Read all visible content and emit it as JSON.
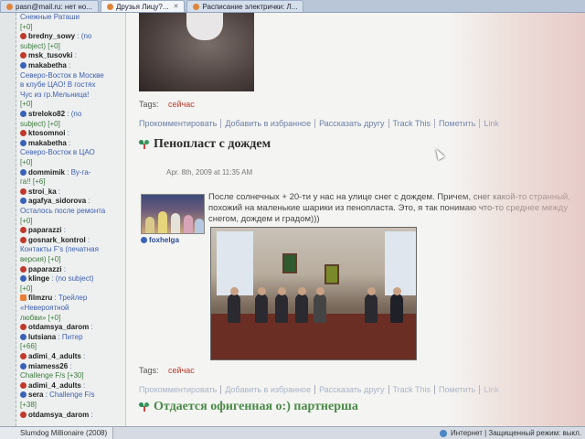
{
  "browser": {
    "tabs": [
      {
        "label": "pasn@mail.ru: нет но...",
        "active": false
      },
      {
        "label": "Друзья Лицу?...",
        "active": true
      },
      {
        "label": "Расписание электрички: Л...",
        "active": false
      }
    ]
  },
  "sidebar": {
    "entries": [
      {
        "kind": "text",
        "text": "Снежные Раташи"
      },
      {
        "kind": "text",
        "text": "[+0]"
      },
      {
        "kind": "user",
        "icon": "red",
        "name": "bredny_sowy",
        "extra": ": (no"
      },
      {
        "kind": "text",
        "text": "subject) [+0]"
      },
      {
        "kind": "user",
        "icon": "red",
        "name": "msk_tusovki",
        "extra": ":"
      },
      {
        "kind": "user",
        "icon": "blue",
        "name": "makabetha",
        "extra": ":"
      },
      {
        "kind": "text",
        "text": "Северо-Восток в Москве"
      },
      {
        "kind": "text",
        "text": "в клубе ЦАО! В гостях"
      },
      {
        "kind": "text",
        "text": "Чус из гр.Мельница!"
      },
      {
        "kind": "text",
        "text": "[+0]"
      },
      {
        "kind": "user",
        "icon": "blue",
        "name": "streloko82",
        "extra": ": (no"
      },
      {
        "kind": "text",
        "text": "subject) [+0]"
      },
      {
        "kind": "user",
        "icon": "red",
        "name": "ktosomnoi",
        "extra": ":"
      },
      {
        "kind": "user",
        "icon": "blue",
        "name": "makabetha",
        "extra": ":"
      },
      {
        "kind": "text",
        "text": "Северо-Восток в ЦАО"
      },
      {
        "kind": "text",
        "text": "[+0]"
      },
      {
        "kind": "user",
        "icon": "blue",
        "name": "dommimik",
        "extra": ": Ву-га-"
      },
      {
        "kind": "text",
        "text": "га!! [+6]"
      },
      {
        "kind": "user",
        "icon": "red",
        "name": "stroi_ka",
        "extra": ":"
      },
      {
        "kind": "user",
        "icon": "blue",
        "name": "agafya_sidorova",
        "extra": ":"
      },
      {
        "kind": "text",
        "text": "Осталось после ремонта"
      },
      {
        "kind": "text",
        "text": "[+0]"
      },
      {
        "kind": "user",
        "icon": "red",
        "name": "paparazzi",
        "extra": ":"
      },
      {
        "kind": "user",
        "icon": "red",
        "name": "gosnark_kontrol",
        "extra": ":"
      },
      {
        "kind": "text",
        "text": "Контакты F's (печатная"
      },
      {
        "kind": "text",
        "text": "версия) [+0]"
      },
      {
        "kind": "user",
        "icon": "red",
        "name": "paparazzi",
        "extra": ":"
      },
      {
        "kind": "user",
        "icon": "blue",
        "name": "klinge",
        "extra": ": (no subject)"
      },
      {
        "kind": "text",
        "text": "[+0]"
      },
      {
        "kind": "user",
        "icon": "rss",
        "name": "filmzru",
        "extra": ": Трейлер"
      },
      {
        "kind": "text",
        "text": "«Невероятной"
      },
      {
        "kind": "text",
        "text": "любви» [+0]"
      },
      {
        "kind": "user",
        "icon": "red",
        "name": "otdamsya_darom",
        "extra": ":"
      },
      {
        "kind": "user",
        "icon": "blue",
        "name": "lutsiana",
        "extra": ": Питер"
      },
      {
        "kind": "text",
        "text": "[+66]"
      },
      {
        "kind": "user",
        "icon": "red",
        "name": "adimi_4_adults",
        "extra": ":"
      },
      {
        "kind": "user",
        "icon": "blue",
        "name": "miamess26",
        "extra": ":"
      },
      {
        "kind": "text",
        "text": "Challenge F/s [+30]"
      },
      {
        "kind": "user",
        "icon": "red",
        "name": "adimi_4_adults",
        "extra": ":"
      },
      {
        "kind": "user",
        "icon": "blue",
        "name": "sera",
        "extra": ": Challenge F/s"
      },
      {
        "kind": "text",
        "text": "[+38]"
      },
      {
        "kind": "user",
        "icon": "red",
        "name": "otdamsya_darom",
        "extra": ":"
      }
    ]
  },
  "post1": {
    "tags_label": "Tags:",
    "tag": "сейчас",
    "actions": [
      "Прокомментировать",
      "Добавить в избранное",
      "Рассказать другу",
      "Track This",
      "Пометить",
      "Link"
    ]
  },
  "post2": {
    "title": "Пенопласт с дождем",
    "date": "Apr. 8th, 2009 at 11:35 AM",
    "author": "foxhelga",
    "text": "После солнечных + 20-ти у нас на улице снег с дождем. Причем, снег какой-то странный, похожий на маленькие шарики из пенопласта. Это, я так понимаю что-то среднее между снегом, дождем и градом)))",
    "tags_label": "Tags:",
    "tag": "сейчас",
    "actions": [
      "Прокомментировать",
      "Добавить в избранное",
      "Рассказать другу",
      "Track This",
      "Пометить",
      "Link"
    ]
  },
  "post3": {
    "title": "Отдается офигенная о:) партнерша"
  },
  "statusbar": {
    "task": "Slumdog Millionaire (2008)",
    "zone": "Интернет | Защищенный режим: выкл."
  },
  "colors": {
    "tag_red": "#c0392b",
    "link_blue": "#6b7fa8",
    "title_green": "#4a8a48"
  }
}
